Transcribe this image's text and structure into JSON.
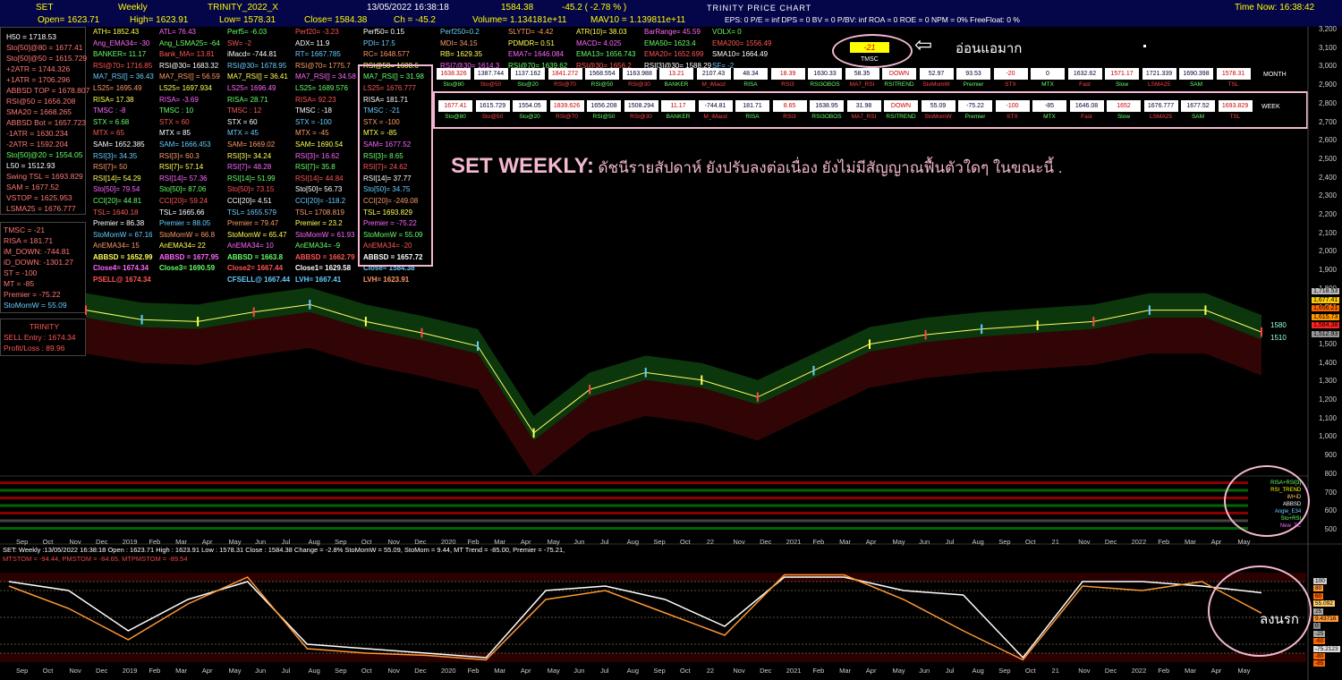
{
  "header": {
    "symbol": "SET",
    "period": "Weekly",
    "system": "TRINITY_2022_X",
    "datetime": "13/05/2022 16:38:18",
    "last": "1584.38",
    "change": "-45.2 ( -2.78 % )",
    "app_title": "TRINITY  PRICE  CHART",
    "time_now": "Time Now: 16:38:42",
    "open": "Open= 1623.71",
    "high": "High= 1623.91",
    "low": "Low= 1578.31",
    "close": "Close= 1584.38",
    "ch": "Ch = -45.2",
    "volume": "Volume= 1.134181e+11",
    "mav10": "MAV10 = 1.139811e+11",
    "fundamentals": "EPS: 0   P/E = inf   DPS = 0   BV = 0   P/BV: inf   ROA = 0   ROE = 0   NPM = 0%   FreeFloat: 0 %"
  },
  "left_panel": {
    "top": [
      "H50 = 1718.53",
      "Sto[50]@80 = 1677.41",
      "Sto[50]@50 = 1615.729",
      "+2ATR = 1744.326",
      "+1ATR = 1706.296",
      "ABBSD TOP = 1678.807",
      "RSI@50 = 1656.208",
      "SMA20 = 1668.265",
      "ABBSD Bot = 1657.723",
      "-1ATR = 1630.234",
      "-2ATR = 1592.204",
      "Sto[50]@20 = 1554.05",
      "L50 = 1512.93",
      "Swing TSL = 1693.829",
      "SAM = 1677.52",
      "VSTOP = 1625.953",
      "LSMA25 = 1676.777"
    ],
    "mid": [
      "TMSC = -21",
      "RISA = 181.71",
      "iM_DOWN: -744.81",
      "iD_DOWN: -1301.27",
      "ST = -100",
      "MT = -85",
      "Premier = -75.22",
      "StoMomW = 55.09"
    ],
    "trinity_title": "TRINITY",
    "sell_entry": "SELL Entry : 1674.34",
    "profit_loss": "Profit/Loss : 89.96"
  },
  "columns": [
    {
      "lines": [
        "ATH= 1852.43",
        "Ang_EMA34= -30",
        "BANKER= 11.17",
        "RSI@70= 1716.85",
        "",
        "MA7_RSI[] = 36.43",
        "LS25= 1695.49",
        "RISA= 17.38",
        "TMSC : -8",
        "STX = 6.68",
        "MTX = 65",
        "SAM= 1652.385",
        "RSI[3]= 34.35",
        "RSI[7]= 50",
        "RSI[14]= 54.29",
        "Sto[50]= 79.54",
        "CCI[20]= 44.81",
        "TSL= 1640.18",
        "Premier = 86.38",
        "StoMomW = 67.16",
        "AnEMA34= 15",
        "ABBSD = 1652.99",
        "Close4= 1674.34",
        "",
        "PSELL@ 1674.34"
      ]
    },
    {
      "lines": [
        "ATL= 76.43",
        "Ang_LSMA25= -64",
        "Bank_MA= 13.81",
        "RSI@30= 1683.32",
        "",
        "MA7_RSI[] = 56.59",
        "LS25= 1697.934",
        "RISA= -3.69",
        "TMSC : 10",
        "STX = 60",
        "MTX = 85",
        "SAM= 1666.453",
        "RSI[3]= 60.3",
        "RSI[7]= 57.14",
        "RSI[14]= 57.36",
        "Sto[50]= 87.06",
        "CCI[20]= 59.24",
        "TSL= 1665.66",
        "Premier = 88.05",
        "StoMomW = 66.8",
        "AnEMA34= 22",
        "ABBSD = 1677.95",
        "Close3= 1690.59"
      ]
    },
    {
      "lines": [
        "Perf5= -6.03",
        "SW= -2",
        "iMacd= -744.81",
        "RSI@30= 1678.95",
        "",
        "MA7_RSI[] = 36.41",
        "LS25= 1696.49",
        "RISA= 28.71",
        "TMSC : 12",
        "STX = 60",
        "MTX = 45",
        "SAM= 1669.02",
        "RSI[3]= 34.24",
        "RSI[7]= 48.28",
        "RSI[14]= 51.99",
        "Sto[50]= 73.15",
        "CCI[20]= 4.51",
        "TSL= 1655.579",
        "Premier = 79.47",
        "StoMomW = 65.47",
        "AnEMA34= 10",
        "ABBSD = 1663.8",
        "Close2= 1667.44",
        "",
        "CFSELL@ 1667.44"
      ]
    },
    {
      "lines": [
        "Perf20= -3.23",
        "ADX= 11.9",
        "RT= 1667.785",
        "RSI@70= 1775.7",
        "",
        "MA7_RSI[] = 34.58",
        "LS25= 1689.576",
        "RISA= 92.23",
        "TMSC : -18",
        "STX = -100",
        "MTX = -45",
        "SAM= 1690.54",
        "RSI[3]= 16.62",
        "RSI[7]= 35.8",
        "RSI[14]= 44.84",
        "Sto[50]= 56.73",
        "CCI[20]= -118.2",
        "TSL= 1708.819",
        "Premier = 23.2",
        "StoMomW = 61.93",
        "AnEMA34= -9",
        "ABBSD = 1662.79",
        "Close1= 1629.58",
        "LVH= 1667.41"
      ]
    },
    {
      "lines": [
        "Perf50= 0.15",
        "PDI= 17.5",
        "RC= 1648.577",
        "RSI@50= 1608.6",
        "",
        "MA7_RSI[] = 31.98",
        "LS25= 1676.777",
        "RISA= 181.71",
        "TMSC : -21",
        "STX = -100",
        "MTX = -85",
        "SAM= 1677.52",
        "RSI[3]= 8.65",
        "RSI[7]= 24.62",
        "RSI[14]= 37.77",
        "Sto[50]= 34.75",
        "CCI[20]= -249.08",
        "TSL= 1693.829",
        "Premier = -75.22",
        "StoMomW = 55.09",
        "AnEMA34= -20",
        "ABBSD = 1657.72",
        "Close= 1584.38",
        "LVH= 1623.91"
      ]
    },
    {
      "lines": [
        "Perf250=0.2",
        "MDI= 34.15",
        "RB= 1629.35",
        "RSI7@30= 1614.3"
      ]
    },
    {
      "lines": [
        "SLYTD= -4.42",
        "PDMDR= 0.51",
        "EMA7= 1646.084",
        "RSI@70= 1639.62"
      ]
    },
    {
      "lines": [
        "ATR(10)= 38.03",
        "MACD= 4.025",
        "EMA13= 1656.743",
        "RSI@30= 1656.2"
      ]
    },
    {
      "lines": [
        "BarRange= 45.59",
        "EMA50= 1623.4",
        "EMA20= 1652.699",
        "RSI[3]@30= 1588.29"
      ]
    },
    {
      "lines": [
        "VOLX= 0",
        "EMA200= 1556.49",
        "SMA10= 1664.49",
        "SF= -2"
      ]
    }
  ],
  "tmsc_box": {
    "value": "-21",
    "label": "TMSC",
    "note": "อ่อนแอมาก"
  },
  "commentary": {
    "title": "SET WEEKLY:",
    "text": "ดัชนีรายสัปดาห์ ยังปรับลงต่อเนื่อง ยังไม่มีสัญญาณฟื้นตัวใดๆ ในขณะนี้ ."
  },
  "month_table": {
    "label": "MONTH",
    "values": [
      "1638.326",
      "1387.744",
      "1137.162",
      "1841.272",
      "1568.554",
      "1163.988",
      "13.21",
      "2107.43",
      "48.34",
      "18.39",
      "1630.33",
      "58.35",
      "DOWN",
      "52.97",
      "93.53",
      "-20",
      "0",
      "1632.62",
      "1571.17",
      "1721.339",
      "1690.398",
      "1578.31"
    ],
    "labels": [
      "Sto@80",
      "Sto@50",
      "Sto@20",
      "RSI@70",
      "RSI@50",
      "RSI@30",
      "BANKER",
      "M_iMacd",
      "RISA",
      "RSI3",
      "RSI3OBOS",
      "MA7_RSI",
      "RSITREND",
      "StoMomW",
      "Premier",
      "STX",
      "MTX",
      "Fast",
      "Slow",
      "LSMA25",
      "SAM",
      "TSL"
    ]
  },
  "week_table": {
    "label": "WEEK",
    "values": [
      "1677.41",
      "1615.729",
      "1554.05",
      "1839.626",
      "1656.208",
      "1508.294",
      "11.17",
      "-744.81",
      "181.71",
      "8.65",
      "1638.95",
      "31.98",
      "DOWN",
      "55.09",
      "-75.22",
      "-100",
      "-85",
      "1646.08",
      "1652",
      "1676.777",
      "1677.52",
      "1693.829"
    ],
    "labels": [
      "Sto@80",
      "Sto@50",
      "Sto@20",
      "RSI@70",
      "RSI@50",
      "RSI@30",
      "BANKER",
      "M_iMacd",
      "RISA",
      "RSI3",
      "RSI3OBOS",
      "MA7_RSI",
      "RSITREND",
      "StoMomW",
      "Premier",
      "STX",
      "MTX",
      "Fast",
      "Slow",
      "LSMA25",
      "SAM",
      "TSL"
    ]
  },
  "price_axis": [
    "3,200",
    "3,100",
    "3,000",
    "2,900",
    "2,800",
    "2,700",
    "2,600",
    "2,500",
    "2,400",
    "2,300",
    "2,200",
    "2,100",
    "2,000",
    "1,900",
    "1,800",
    "1,700",
    "1,600",
    "1,500",
    "1,400",
    "1,300",
    "1,200",
    "1,100",
    "1,000",
    "900",
    "800",
    "700",
    "600",
    "500"
  ],
  "price_tags": [
    "1,718.53",
    "1,677.41",
    "1,656.21",
    "1,615.73",
    "1,584.38",
    "1,512.93"
  ],
  "price_side_labels": [
    "1580",
    "1510"
  ],
  "time_axis": [
    "Sep",
    "Oct",
    "Nov",
    "Dec",
    "2019",
    "Feb",
    "Mar",
    "Apr",
    "May",
    "Jun",
    "Jul",
    "Aug",
    "Sep",
    "Oct",
    "Nov",
    "Dec",
    "2020",
    "Feb",
    "Mar",
    "Apr",
    "May",
    "Jun",
    "Jul",
    "Aug",
    "Sep",
    "Oct",
    "22",
    "Nov",
    "Dec",
    "2021",
    "Feb",
    "Mar",
    "Apr",
    "May",
    "Jun",
    "Jul",
    "Aug",
    "Sep",
    "Oct",
    "21",
    "Nov",
    "Dec",
    "2022",
    "Feb",
    "Mar",
    "Apr",
    "May"
  ],
  "indicator_legend": [
    "RISA+RSI[3]",
    "RSI_TREND",
    "iM+iD",
    "ABBSD",
    "Angle_E34",
    "Sto+RSI",
    "New_TC"
  ],
  "osc_title": "SET: Weekly :13/05/2022 16:38:18 Open : 1623.71 High : 1623.91 Low : 1578.31 Close : 1584.38 Change = -2.8% StoMomW = 55.09, StoMom = 9.44,  MT Trend = -85.00, Premier = -75.21,",
  "osc_title2": "MTSTOM = -94.44,   PMSTOM = -84.65,   MTPMSTOM = -89.54",
  "osc_axis": [
    "100",
    "80",
    "60",
    "55.092",
    "25",
    "9.43716",
    "0",
    "-25",
    "-60",
    "-75.2123",
    "-80",
    "-85"
  ],
  "osc_note": "ลงนรก",
  "colors": {
    "header_bg": "#05054a",
    "cloud": "#0d3d0d",
    "red_cloud": "#3a0606",
    "highlight": "#f3b8d0"
  },
  "chart_data": {
    "type": "line",
    "title": "SET Weekly",
    "x": [
      "2018-09",
      "2018-12",
      "2019-03",
      "2019-06",
      "2019-07",
      "2019-09",
      "2019-12",
      "2020-02",
      "2020-03",
      "2020-04",
      "2020-06",
      "2020-08",
      "2020-10",
      "2020-11",
      "2021-01",
      "2021-04",
      "2021-07",
      "2021-09",
      "2021-12",
      "2022-02",
      "2022-04",
      "2022-05"
    ],
    "series": [
      {
        "values": [
          1700,
          1650,
          1640,
          1690,
          1730,
          1640,
          1580,
          1510,
          1050,
          1280,
          1370,
          1330,
          1240,
          1380,
          1520,
          1570,
          1600,
          1620,
          1640,
          1700,
          1700,
          1584
        ]
      }
    ],
    "ylim": [
      500,
      3200
    ],
    "oscillator": {
      "ylim": [
        -100,
        100
      ],
      "series": [
        {
          "name": "StoMomW",
          "values": [
            80,
            60,
            -30,
            40,
            80,
            -60,
            -70,
            -80,
            -90,
            60,
            70,
            40,
            -20,
            90,
            90,
            60,
            50,
            -90,
            80,
            80,
            70,
            55.09
          ]
        },
        {
          "name": "StoMom",
          "values": [
            70,
            20,
            -50,
            30,
            90,
            -70,
            -80,
            -85,
            -95,
            40,
            60,
            10,
            -40,
            95,
            95,
            40,
            -30,
            -95,
            70,
            60,
            80,
            9.44
          ]
        }
      ]
    }
  }
}
